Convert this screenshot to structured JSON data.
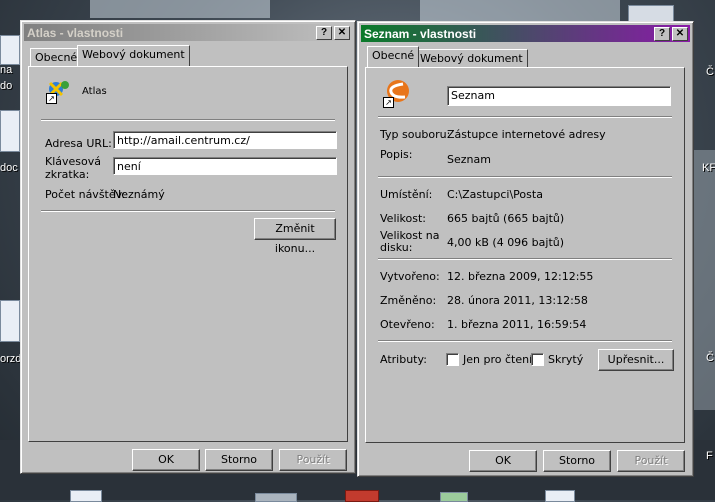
{
  "desktop": {
    "icon_labels": [
      "na",
      "do",
      "doc",
      "orzd.",
      "KF",
      "Č",
      "Č",
      "F"
    ]
  },
  "atlas_window": {
    "title": "Atlas - vlastnosti",
    "help_btn": "?",
    "close_btn": "✕",
    "tabs": [
      "Obecné",
      "Webový dokument"
    ],
    "name": "Atlas",
    "url_label": "Adresa URL:",
    "url_value": "http://amail.centrum.cz/",
    "hotkey_label": "Klávesová zkratka:",
    "hotkey_value": "není",
    "visits_label": "Počet návštěv:",
    "visits_value": "Neznámý",
    "change_icon_btn": "Změnit ikonu...",
    "ok": "OK",
    "cancel": "Storno",
    "apply": "Použít"
  },
  "seznam_window": {
    "title": "Seznam - vlastnosti",
    "help_btn": "?",
    "close_btn": "✕",
    "tabs": [
      "Obecné",
      "Webový dokument"
    ],
    "name_value": "Seznam",
    "type_label": "Typ souboru:",
    "type_value": "Zástupce internetové adresy",
    "desc_label": "Popis:",
    "desc_value": "Seznam",
    "location_label": "Umístění:",
    "location_value": "C:\\Zastupci\\Posta",
    "size_label": "Velikost:",
    "size_value": "665 bajtů (665 bajtů)",
    "disk_size_label": "Velikost na disku:",
    "disk_size_value": "4,00 kB (4 096 bajtů)",
    "created_label": "Vytvořeno:",
    "created_value": "12. března 2009, 12:12:55",
    "modified_label": "Změněno:",
    "modified_value": "28. února 2011, 13:12:58",
    "opened_label": "Otevřeno:",
    "opened_value": "1. března 2011, 16:59:54",
    "attr_label": "Atributy:",
    "readonly_label": "Jen pro čtení",
    "hidden_label": "Skrytý",
    "advanced_btn": "Upřesnit...",
    "ok": "OK",
    "cancel": "Storno",
    "apply": "Použít",
    "active_title_colors": [
      "#0a7a2a",
      "#8a1aa8"
    ]
  }
}
